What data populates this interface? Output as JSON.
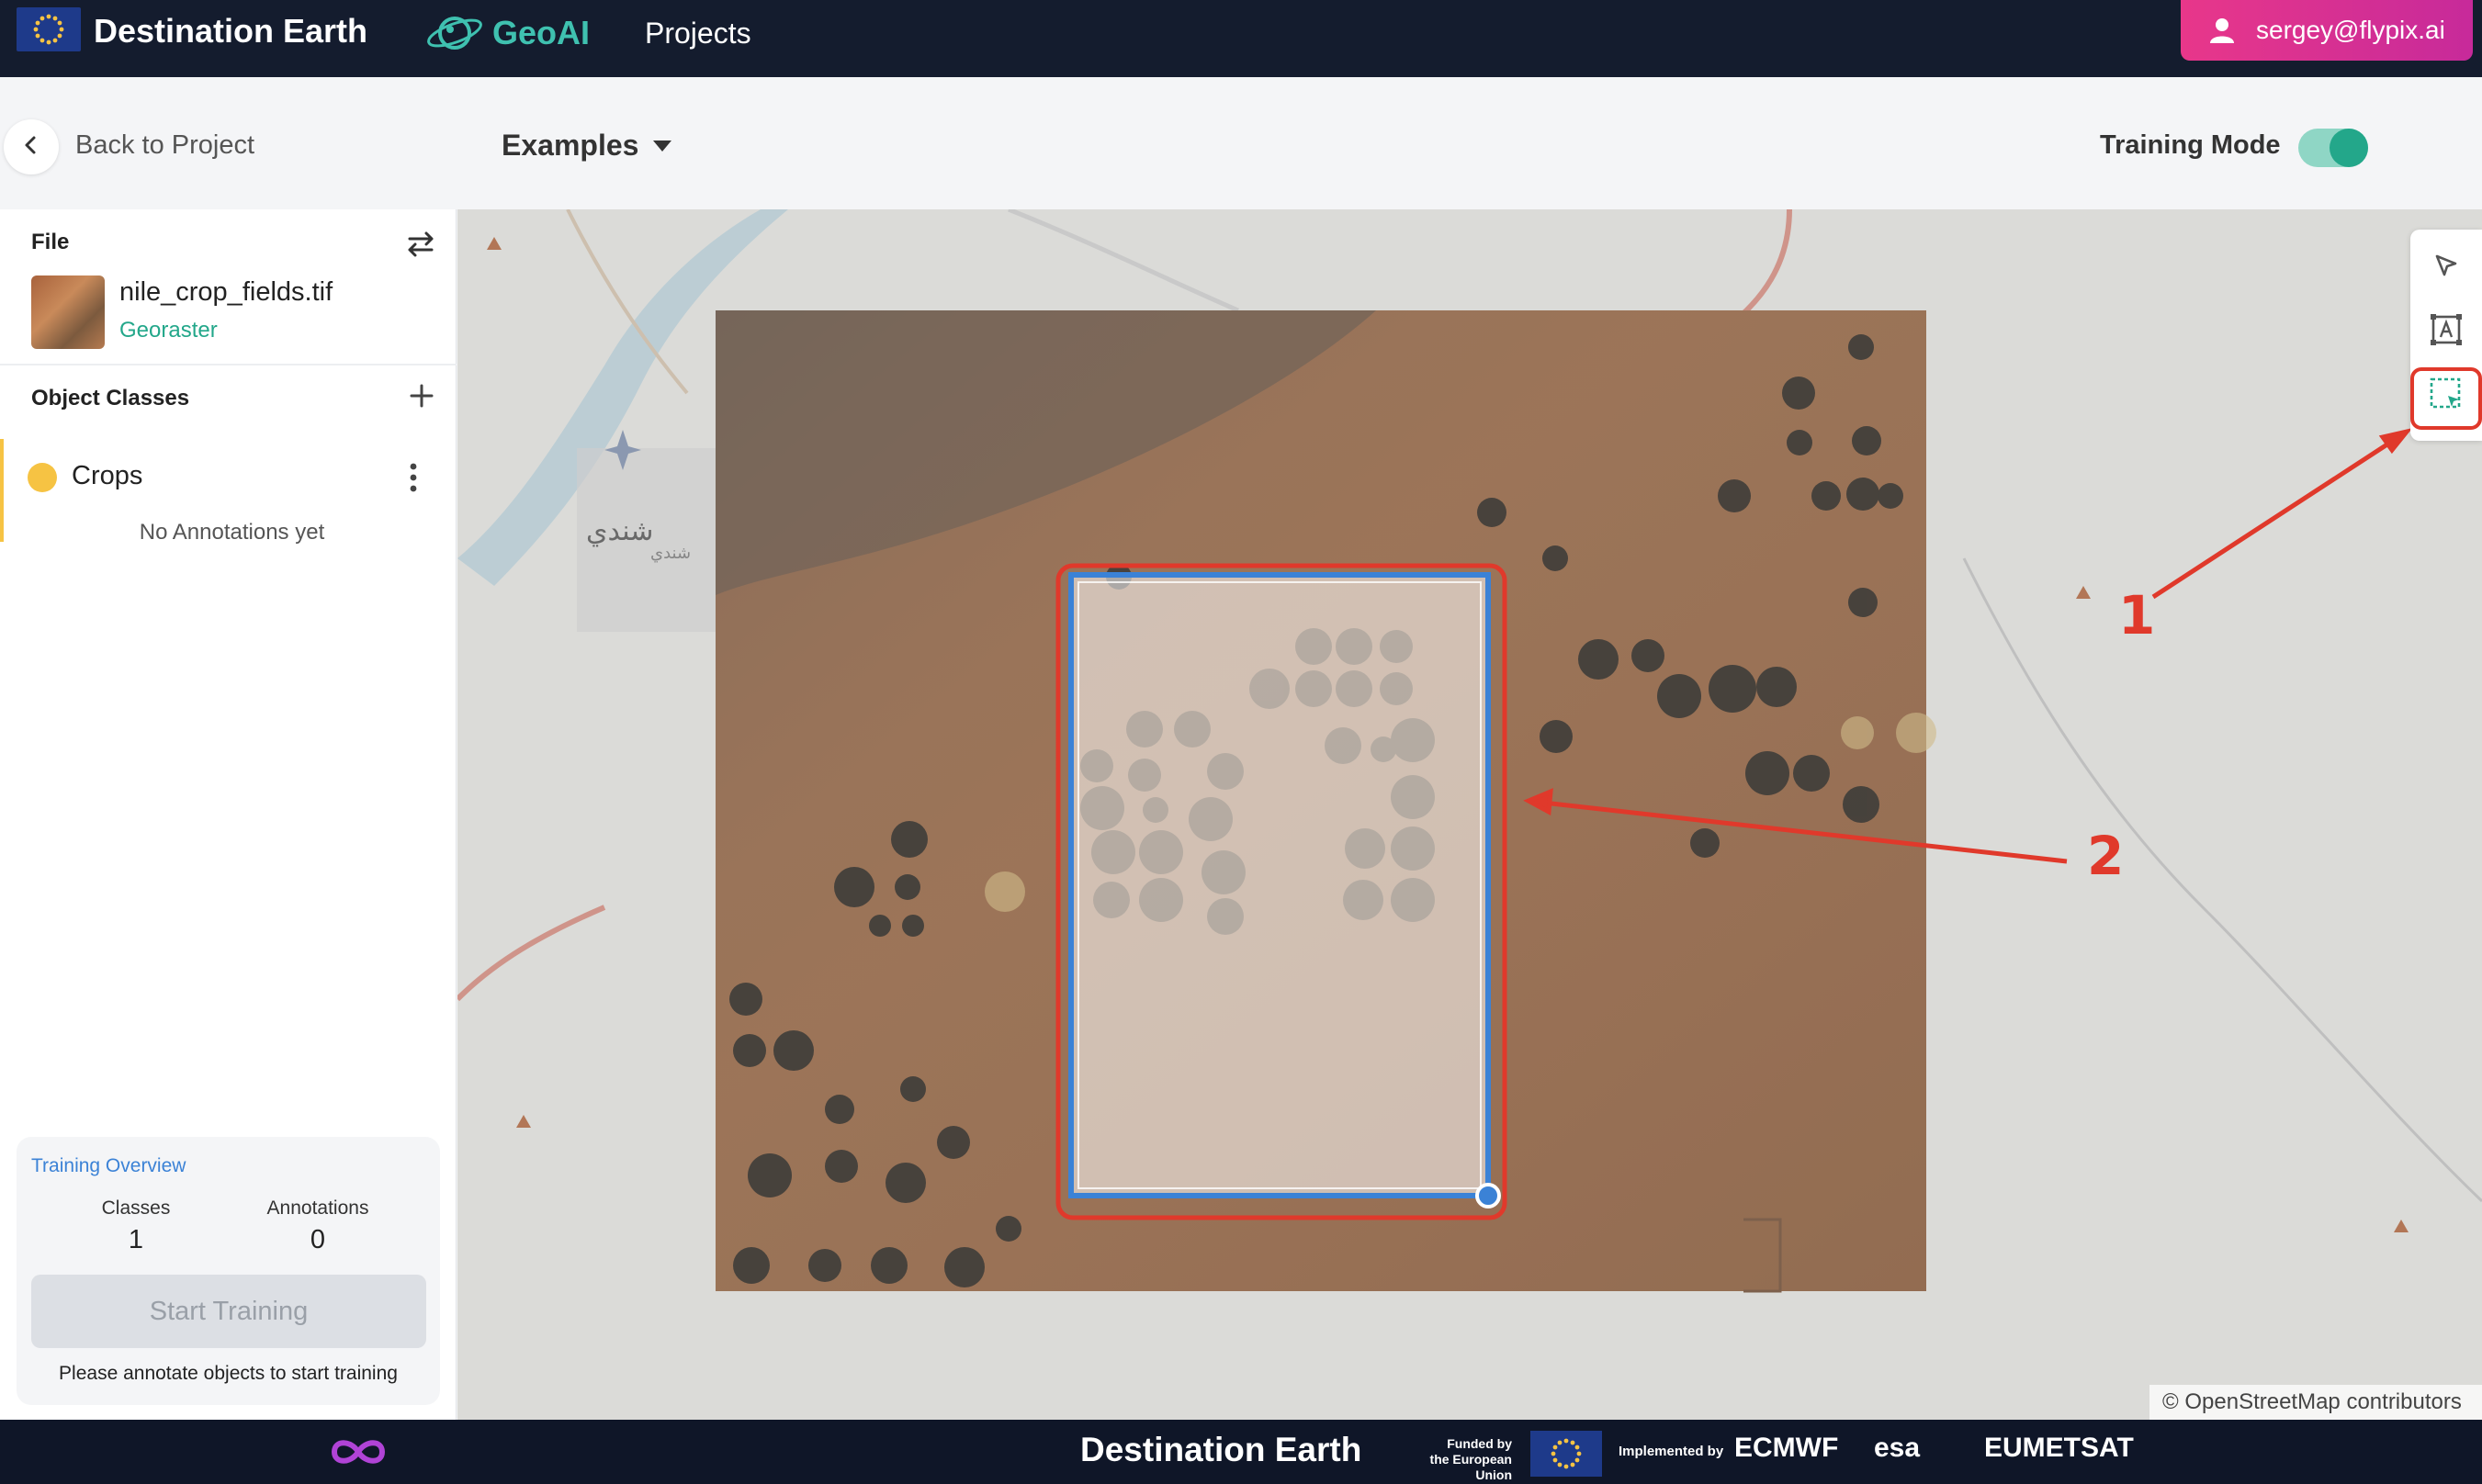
{
  "header": {
    "brand": "Destination Earth",
    "app_name": "GeoAI",
    "projects_link": "Projects",
    "user_email": "sergey@flypix.ai"
  },
  "subheader": {
    "back_label": "Back to Project",
    "examples_label": "Examples",
    "training_mode_label": "Training Mode",
    "training_mode_on": true
  },
  "sidebar": {
    "file_section_label": "File",
    "file_name": "nile_crop_fields.tif",
    "file_type": "Georaster",
    "object_classes_label": "Object Classes",
    "classes": [
      {
        "name": "Crops",
        "color": "#f6c343",
        "annotations_text": "No Annotations yet"
      }
    ]
  },
  "training_overview": {
    "title": "Training Overview",
    "classes_label": "Classes",
    "classes_value": "1",
    "annotations_label": "Annotations",
    "annotations_value": "0",
    "start_button": "Start Training",
    "hint": "Please annotate objects to start training"
  },
  "map": {
    "city_label_ar": "شندي",
    "city_label_ar_small": "شندي",
    "attribution": "© OpenStreetMap contributors",
    "callouts": [
      {
        "number": "1",
        "color": "#e0392b"
      },
      {
        "number": "2",
        "color": "#e0392b"
      }
    ]
  },
  "footer": {
    "brand": "Destination Earth",
    "funded_line1": "Funded by",
    "funded_line2": "the European Union",
    "implemented_by": "Implemented by",
    "partners": [
      "ECMWF",
      "esa",
      "EUMETSAT"
    ]
  },
  "colors": {
    "accent_teal": "#23a78a",
    "user_pink": "#e8378a",
    "annotation_red": "#e0392b",
    "selection_blue": "#3b82d6"
  }
}
